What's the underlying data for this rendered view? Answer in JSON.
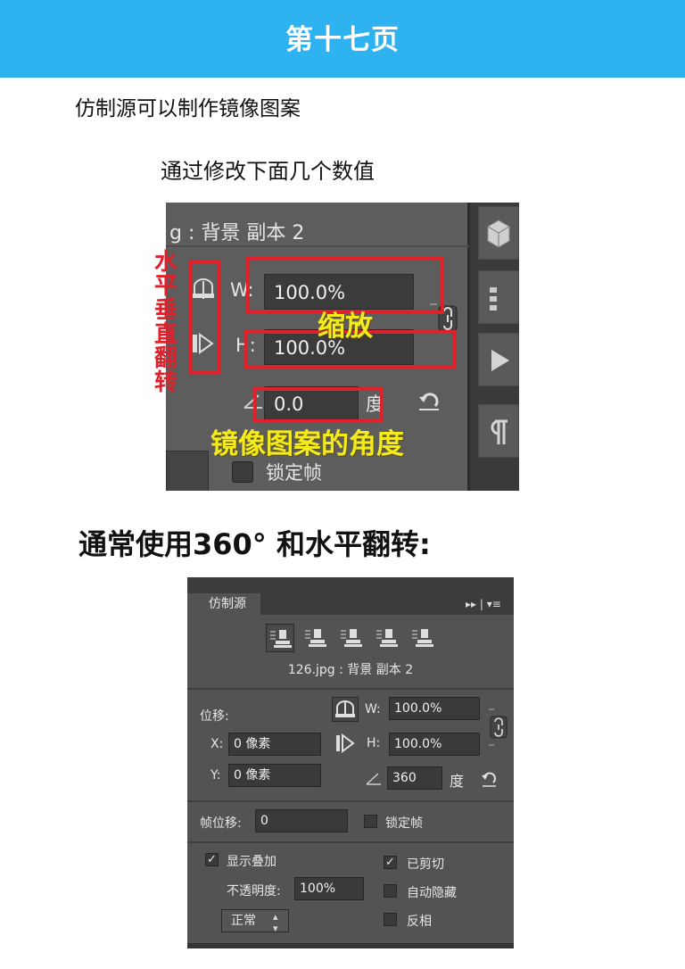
{
  "header": {
    "title": "第十七页",
    "bg_color": "#2fb2f0"
  },
  "intro": "仿制源可以制作镜像图案",
  "subheading": "通过修改下面几个数值",
  "shot1": {
    "source_label": "g : 背景  副本 2",
    "w_label": "W:",
    "w_value": "100.0%",
    "h_label": "H:",
    "h_value": "100.0%",
    "angle_value": "0.0",
    "degree_label": "度",
    "lock_frame_label": "锁定帧"
  },
  "annotations": {
    "flip_label": "水平垂直翻转",
    "scale_label": "缩放",
    "angle_label": "镜像图案的角度",
    "red_color": "#e0202a",
    "yellow_color": "#f5ea1c"
  },
  "common_usage": "通常使用360° 和水平翻转:",
  "panel": {
    "tab_label": "仿制源",
    "menu_glyphs": "▸▸ | ▾≡",
    "source_label": "126.jpg : 背景  副本 2",
    "offset_label": "位移:",
    "w_label": "W:",
    "w_value": "100.0%",
    "h_label": "H:",
    "h_value": "100.0%",
    "x_label": "X:",
    "x_value": "0 像素",
    "y_label": "Y:",
    "y_value": "0 像素",
    "angle_value": "360",
    "degree_label": "度",
    "frame_offset_label": "帧位移:",
    "frame_offset_value": "0",
    "lock_frame_label": "锁定帧",
    "show_overlay_label": "显示叠加",
    "opacity_label": "不透明度:",
    "opacity_value": "100%",
    "blend_mode": "正常",
    "clipped_label": "已剪切",
    "auto_hide_label": "自动隐藏",
    "invert_label": "反相",
    "show_overlay_checked": "✓",
    "clipped_checked": "✓"
  }
}
